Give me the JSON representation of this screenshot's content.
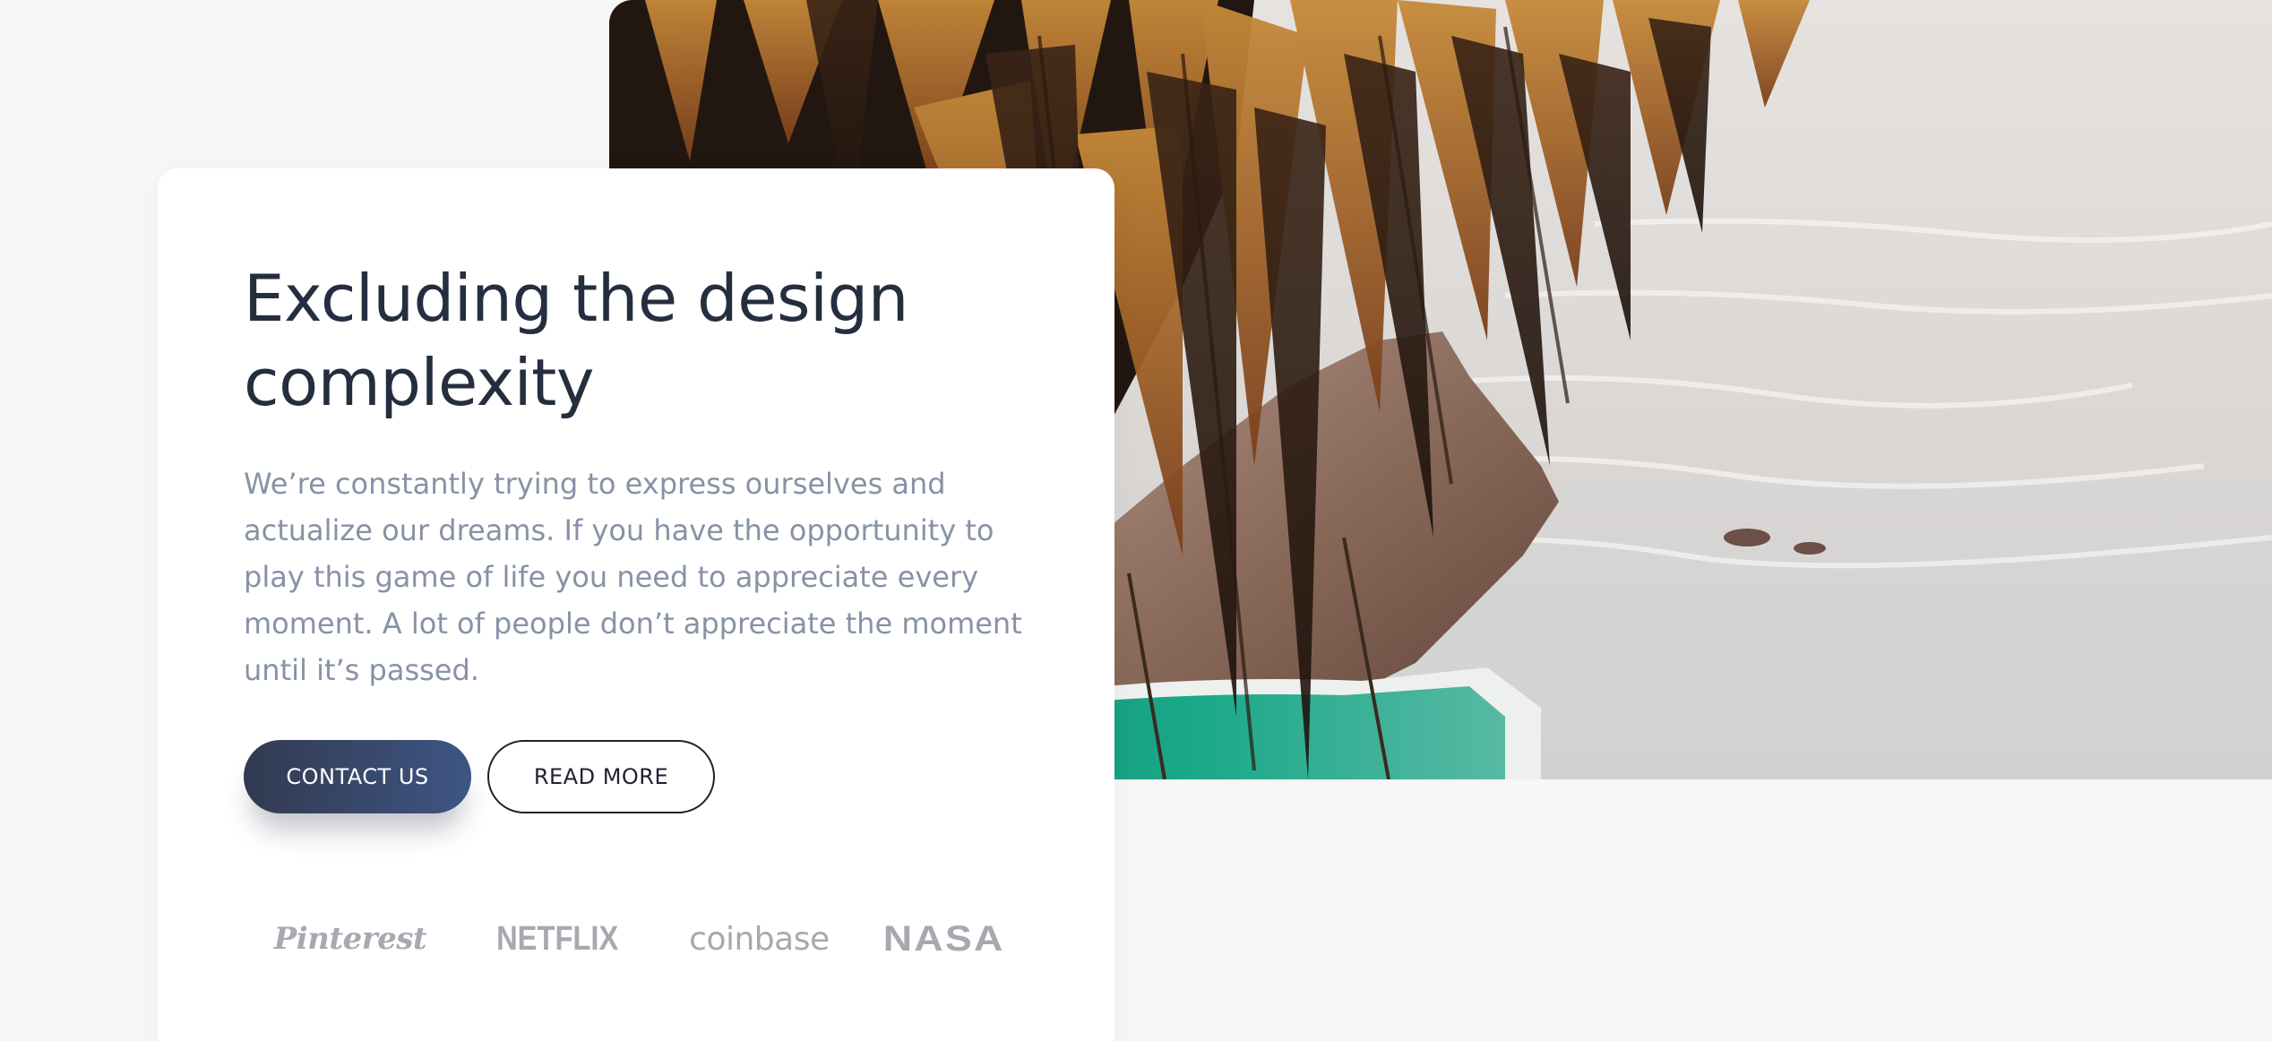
{
  "hero": {
    "image_name": "palm-trees-sea-cliff-photo"
  },
  "card": {
    "title": "Excluding the design complexity",
    "description": "We’re constantly trying to express ourselves and actualize our dreams. If you have the opportunity to play this game of life you need to appreciate every moment. A lot of people don’t appreciate the moment until it’s passed.",
    "buttons": {
      "contact_label": "CONTACT US",
      "read_more_label": "READ MORE"
    },
    "logos": [
      {
        "name": "pinterest-logo",
        "label": "Pinterest"
      },
      {
        "name": "netflix-logo",
        "label": "NETFLIX"
      },
      {
        "name": "coinbase-logo",
        "label": "coinbase"
      },
      {
        "name": "nasa-logo",
        "label": "NASA"
      }
    ]
  },
  "colors": {
    "background": "#f7f7f7",
    "card": "#ffffff",
    "title": "#252e3f",
    "body_text": "#8792a6",
    "primary_button_start": "#323a50",
    "primary_button_end": "#3e5584",
    "logo": "#a7a9b0"
  }
}
